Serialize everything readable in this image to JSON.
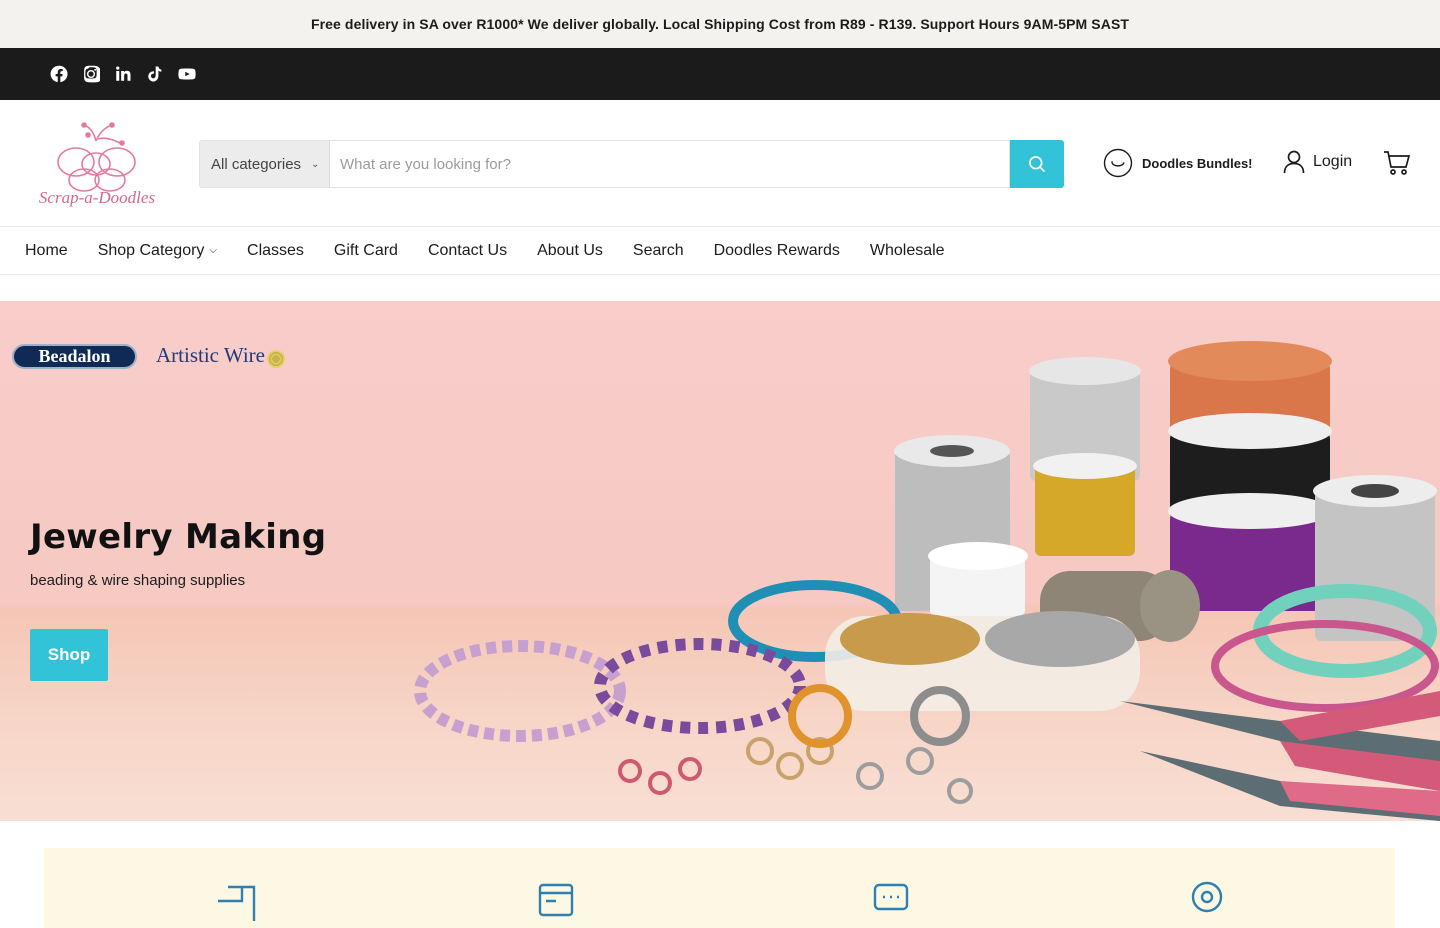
{
  "announcement": {
    "text": "Free delivery in SA over R1000* We deliver globally. Local Shipping Cost from R89 - R139. Support Hours 9AM-5PM SAST"
  },
  "social": {
    "icons": [
      "facebook-icon",
      "instagram-icon",
      "linkedin-icon",
      "tiktok-icon",
      "youtube-icon"
    ]
  },
  "header": {
    "logo_text": "Scrap-a-Doodles",
    "category_select": "All categories",
    "search_placeholder": "What are you looking for?",
    "bundles_label": "Doodles Bundles!",
    "login_label": "Login"
  },
  "nav": {
    "items": [
      {
        "label": "Home"
      },
      {
        "label": "Shop Category"
      },
      {
        "label": "Classes"
      },
      {
        "label": "Gift Card"
      },
      {
        "label": "Contact Us"
      },
      {
        "label": "About Us"
      },
      {
        "label": "Search"
      },
      {
        "label": "Doodles Rewards"
      },
      {
        "label": "Wholesale"
      }
    ]
  },
  "hero": {
    "brand_1": "Beadalon",
    "brand_2": "Artistic Wire",
    "title": "Jewelry Making",
    "subtitle": "beading & wire shaping supplies",
    "button": "Shop"
  },
  "colors": {
    "accent": "#33c3d8",
    "social_bar": "#1c1b1b",
    "announcement_bg": "#f3f2ef",
    "hero_bg": "#f8cdca",
    "features_bg": "#fdf8e3",
    "feature_icon": "#2e7fb2"
  },
  "features": {
    "icons": [
      "delivery-icon",
      "payment-icon",
      "chat-icon",
      "location-icon"
    ]
  }
}
